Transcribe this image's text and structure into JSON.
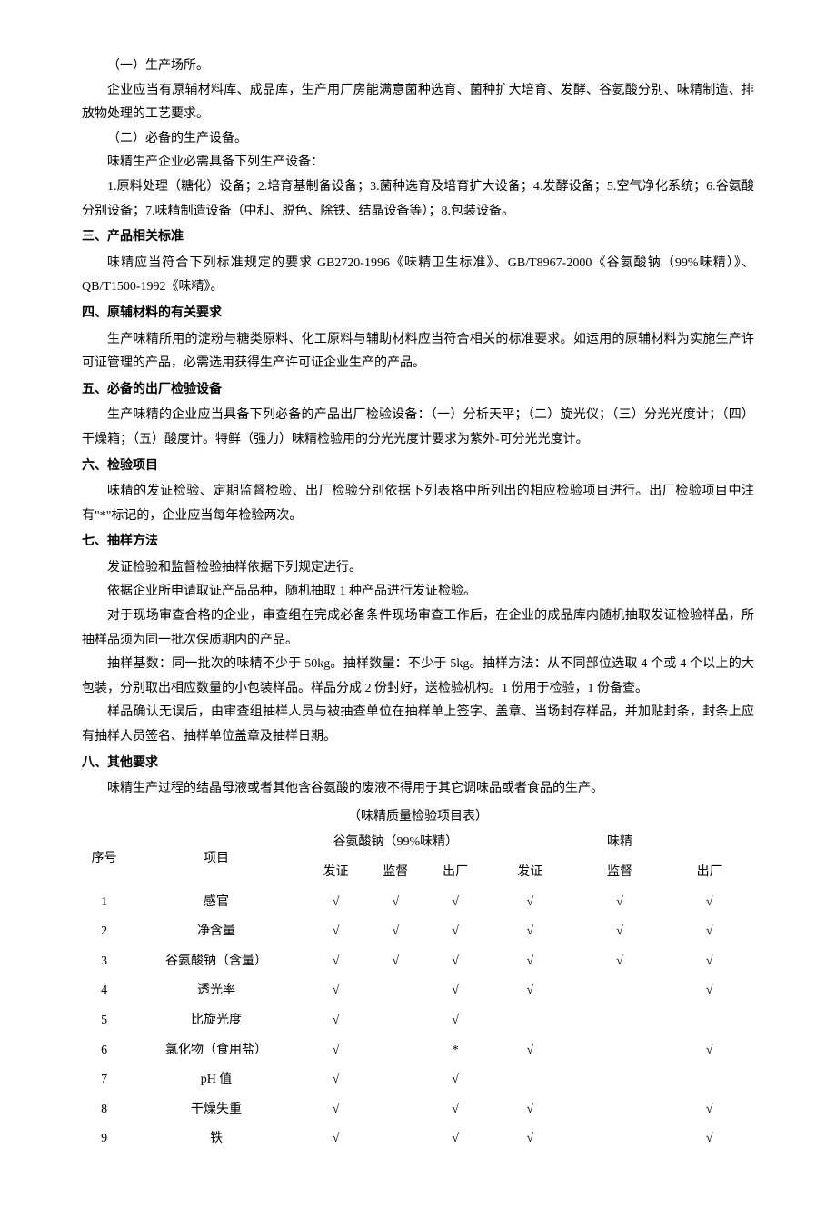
{
  "paragraphs": {
    "p1": "（一）生产场所。",
    "p2": "企业应当有原辅材料库、成品库，生产用厂房能满意菌种选育、菌种扩大培育、发酵、谷氨酸分别、味精制造、排放物处理的工艺要求。",
    "p3": "（二）必备的生产设备。",
    "p4": "味精生产企业必需具备下列生产设备：",
    "p5": "1.原料处理（糖化）设备；2.培育基制备设备；3.菌种选育及培育扩大设备；4.发酵设备；5.空气净化系统；6.谷氨酸分别设备；7.味精制造设备（中和、脱色、除铁、结晶设备等）；8.包装设备。"
  },
  "sections": {
    "s3_heading": "三、产品相关标准",
    "s3_body": "味精应当符合下列标准规定的要求 GB2720-1996《味精卫生标准》、GB/T8967-2000《谷氨酸钠（99%味精）》、QB/T1500-1992《味精》。",
    "s4_heading": "四、原辅材料的有关要求",
    "s4_body": "生产味精所用的淀粉与糖类原料、化工原料与辅助材料应当符合相关的标准要求。如运用的原辅材料为实施生产许可证管理的产品，必需选用获得生产许可证企业生产的产品。",
    "s5_heading": "五、必备的出厂检验设备",
    "s5_body": "生产味精的企业应当具备下列必备的产品出厂检验设备：（一）分析天平；（二）旋光仪；（三）分光光度计；（四）干燥箱；（五）酸度计。特鲜（强力）味精检验用的分光光度计要求为紫外-可分光光度计。",
    "s6_heading": "六、检验项目",
    "s6_body": "味精的发证检验、定期监督检验、出厂检验分别依据下列表格中所列出的相应检验项目进行。出厂检验项目中注有\"*\"标记的，企业应当每年检验两次。",
    "s7_heading": "七、抽样方法",
    "s7_p1": "发证检验和监督检验抽样依据下列规定进行。",
    "s7_p2": "依据企业所申请取证产品品种，随机抽取 1 种产品进行发证检验。",
    "s7_p3": "对于现场审查合格的企业，审查组在完成必备条件现场审查工作后，在企业的成品库内随机抽取发证检验样品，所抽样品须为同一批次保质期内的产品。",
    "s7_p4": "抽样基数：同一批次的味精不少于 50kg。抽样数量：不少于 5kg。抽样方法：从不同部位选取 4 个或 4 个以上的大包装，分别取出相应数量的小包装样品。样品分成 2 份封好，送检验机构。1 份用于检验，1 份备查。",
    "s7_p5": "样品确认无误后，由审查组抽样人员与被抽查单位在抽样单上签字、盖章、当场封存样品，并加贴封条，封条上应有抽样人员签名、抽样单位盖章及抽样日期。",
    "s8_heading": "八、其他要求",
    "s8_body": "味精生产过程的结晶母液或者其他含谷氨酸的废液不得用于其它调味品或者食品的生产。"
  },
  "table": {
    "title": "（味精质量检验项目表）",
    "header": {
      "seq": "序号",
      "item": "项目",
      "group1": "谷氨酸钠（99%味精）",
      "group2": "味精",
      "sub_fazheng": "发证",
      "sub_jiandu": "监督",
      "sub_chuchang": "出厂"
    },
    "rows": [
      {
        "seq": "1",
        "item": "感官",
        "g1f": "√",
        "g1j": "√",
        "g1c": "√",
        "g2f": "√",
        "g2j": "√",
        "g2c": "√"
      },
      {
        "seq": "2",
        "item": "净含量",
        "g1f": "√",
        "g1j": "√",
        "g1c": "√",
        "g2f": "√",
        "g2j": "√",
        "g2c": "√"
      },
      {
        "seq": "3",
        "item": "谷氨酸钠（含量）",
        "g1f": "√",
        "g1j": "√",
        "g1c": "√",
        "g2f": "√",
        "g2j": "√",
        "g2c": "√"
      },
      {
        "seq": "4",
        "item": "透光率",
        "g1f": "√",
        "g1j": "",
        "g1c": "√",
        "g2f": "√",
        "g2j": "",
        "g2c": "√"
      },
      {
        "seq": "5",
        "item": "比旋光度",
        "g1f": "√",
        "g1j": "",
        "g1c": "√",
        "g2f": "",
        "g2j": "",
        "g2c": ""
      },
      {
        "seq": "6",
        "item": "氯化物（食用盐）",
        "g1f": "√",
        "g1j": "",
        "g1c": "*",
        "g2f": "√",
        "g2j": "",
        "g2c": "√"
      },
      {
        "seq": "7",
        "item": "pH 值",
        "g1f": "√",
        "g1j": "",
        "g1c": "√",
        "g2f": "",
        "g2j": "",
        "g2c": ""
      },
      {
        "seq": "8",
        "item": "干燥失重",
        "g1f": "√",
        "g1j": "",
        "g1c": "√",
        "g2f": "√",
        "g2j": "",
        "g2c": "√"
      },
      {
        "seq": "9",
        "item": "铁",
        "g1f": "√",
        "g1j": "",
        "g1c": "√",
        "g2f": "√",
        "g2j": "",
        "g2c": "√"
      }
    ]
  }
}
